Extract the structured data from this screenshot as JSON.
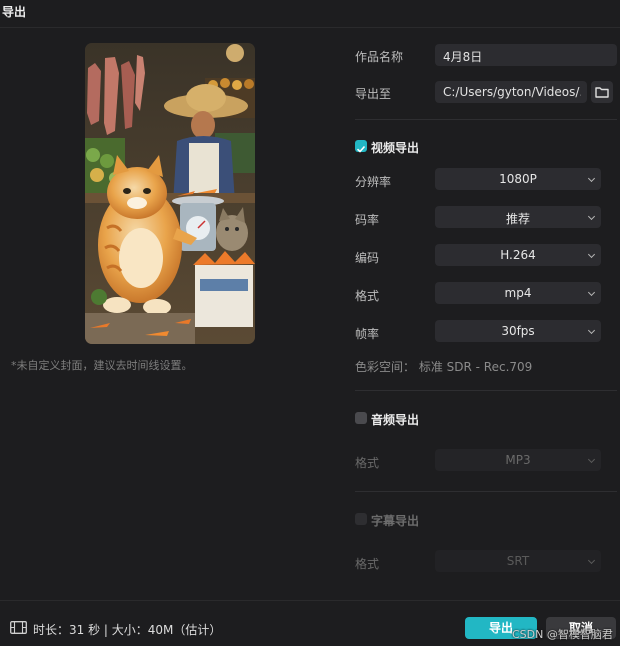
{
  "window": {
    "title": "导出"
  },
  "preview": {
    "cover_hint": "*未自定义封面，建议去时间线设置。"
  },
  "form": {
    "name_label": "作品名称",
    "name_value": "4月8日",
    "export_to_label": "导出至",
    "export_to_value": "C:/Users/gyton/Videos/...",
    "folder_icon": "folder-icon"
  },
  "video": {
    "section_label": "视频导出",
    "checked": true,
    "resolution_label": "分辨率",
    "resolution_value": "1080P",
    "bitrate_label": "码率",
    "bitrate_value": "推荐",
    "codec_label": "编码",
    "codec_value": "H.264",
    "format_label": "格式",
    "format_value": "mp4",
    "framerate_label": "帧率",
    "framerate_value": "30fps",
    "color_space": "色彩空间：  标准 SDR - Rec.709"
  },
  "audio": {
    "section_label": "音频导出",
    "checked": false,
    "format_label": "格式",
    "format_value": "MP3"
  },
  "subtitle": {
    "section_label": "字幕导出",
    "checked": false,
    "format_label": "格式",
    "format_value": "SRT"
  },
  "footer": {
    "film_icon": "film-icon",
    "info": "时长：31 秒 | 大小：40M（估计）",
    "export_label": "导出",
    "cancel_label": "取消",
    "watermark": "CSDN @智模智脑君"
  },
  "colors": {
    "accent": "#22b7c4",
    "background": "#1d1d1f",
    "field": "#2c2c30"
  }
}
